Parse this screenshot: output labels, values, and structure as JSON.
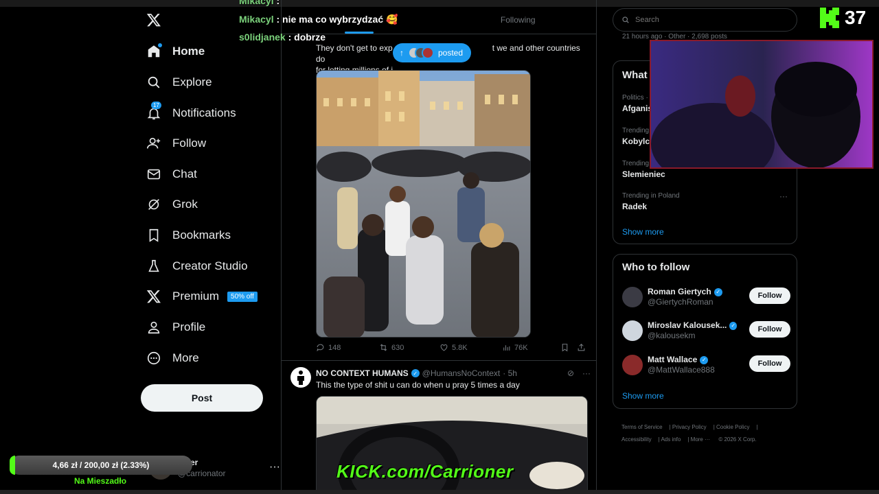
{
  "chat": [
    {
      "user": "Mikacyl",
      "message": ""
    },
    {
      "user": "Mikacyl",
      "message": "nie ma co wybrzydzać 🥰"
    },
    {
      "user": "s0lidjanek",
      "message": "dobrze"
    }
  ],
  "viewer_count": "37",
  "nav": {
    "items": [
      {
        "label": "Home",
        "icon": "home-icon"
      },
      {
        "label": "Explore",
        "icon": "search-icon"
      },
      {
        "label": "Notifications",
        "icon": "bell-icon",
        "badge": "17"
      },
      {
        "label": "Follow",
        "icon": "follow-icon"
      },
      {
        "label": "Chat",
        "icon": "mail-icon"
      },
      {
        "label": "Grok",
        "icon": "grok-icon"
      },
      {
        "label": "Bookmarks",
        "icon": "bookmark-icon"
      },
      {
        "label": "Creator Studio",
        "icon": "flask-icon"
      },
      {
        "label": "Premium",
        "icon": "x-logo-icon",
        "promo": "50% off"
      },
      {
        "label": "Profile",
        "icon": "person-icon"
      },
      {
        "label": "More",
        "icon": "more-circle-icon"
      }
    ],
    "post_label": "Post",
    "account": {
      "name": "ioner",
      "handle": "@carrionator"
    }
  },
  "timeline": {
    "tabs": [
      "",
      "Following"
    ],
    "posted_pill": "posted",
    "tweet1": {
      "text_line1": "They don't get to exp",
      "text_line1_end": "t we and other countries do",
      "text_line2": "for letting millions of i",
      "stats": {
        "replies": "148",
        "reposts": "630",
        "likes": "5.8K",
        "views": "76K"
      }
    },
    "tweet2": {
      "name": "NO CONTEXT HUMANS",
      "handle": "@HumansNoContext",
      "time": "· 5h",
      "text": "This the type of shit u can do when u pray 5 times a day"
    }
  },
  "right": {
    "search_placeholder": "Search",
    "meta_line": "21 hours ago · Other · 2,698 posts",
    "trends_title": "What",
    "trends": [
      {
        "category": "Politics ·",
        "name": "Afganis"
      },
      {
        "category": "Trending",
        "name": "Kobylc"
      },
      {
        "category": "Trending",
        "name": "Slemieniec"
      },
      {
        "category": "Trending in Poland",
        "name": "Radek"
      }
    ],
    "show_more": "Show more",
    "wtf_title": "Who to follow",
    "who_to_follow": [
      {
        "name": "Roman Giertych",
        "handle": "@GiertychRoman"
      },
      {
        "name": "Miroslav Kalousek...",
        "handle": "@kalousekm"
      },
      {
        "name": "Matt Wallace",
        "handle": "@MattWallace888"
      }
    ],
    "follow_label": "Follow",
    "footer": [
      "Terms of Service",
      "Privacy Policy",
      "Cookie Policy",
      "Accessibility",
      "Ads info",
      "More ···",
      "© 2026 X Corp."
    ]
  },
  "donation": {
    "text": "4,66 zł / 200,00 zł (2.33%)",
    "progress": 0.0233,
    "label": "Na Mieszadło"
  },
  "kick_url": "KICK.com/Carrioner",
  "colors": {
    "accent": "#1d9bf0",
    "kick_green": "#53fc18",
    "background": "#000000"
  }
}
